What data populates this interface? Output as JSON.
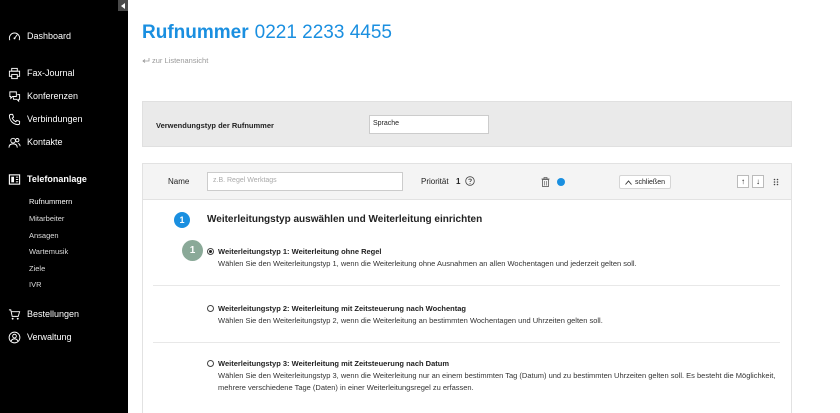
{
  "sidebar": {
    "items": [
      {
        "label": "Dashboard",
        "icon": "gauge-icon"
      },
      {
        "label": "Fax-Journal",
        "icon": "printer-icon"
      },
      {
        "label": "Konferenzen",
        "icon": "chat-icon"
      },
      {
        "label": "Verbindungen",
        "icon": "phone-icon"
      },
      {
        "label": "Kontakte",
        "icon": "contacts-icon"
      },
      {
        "label": "Telefonanlage",
        "icon": "pbx-icon"
      },
      {
        "label": "Bestellungen",
        "icon": "cart-icon"
      },
      {
        "label": "Verwaltung",
        "icon": "user-circle-icon"
      }
    ],
    "subitems": [
      {
        "label": "Rufnummern"
      },
      {
        "label": "Mitarbeiter"
      },
      {
        "label": "Ansagen"
      },
      {
        "label": "Wartemusik"
      },
      {
        "label": "Ziele"
      },
      {
        "label": "IVR"
      }
    ]
  },
  "header": {
    "title": "Rufnummer",
    "number": "0221 2233 4455",
    "back_link": "zur Listenansicht"
  },
  "usage": {
    "label": "Verwendungstyp der Rufnummer",
    "value": "Sprache"
  },
  "rule": {
    "name_label": "Name",
    "name_placeholder": "z.B. Regel Werktags",
    "priority_label": "Priorität",
    "priority_value": "1",
    "close_label": "schließen",
    "up_arrow": "↑",
    "down_arrow": "↓"
  },
  "section": {
    "step": "1",
    "title": "Weiterleitungstyp auswählen und Weiterleitung einrichten",
    "marker": "1",
    "options": [
      {
        "title": "Weiterleitungstyp 1: Weiterleitung ohne Regel",
        "desc": "Wählen Sie den Weiterleitungstyp 1, wenn die Weiterleitung ohne Ausnahmen an allen Wochentagen und jederzeit gelten soll.",
        "checked": true
      },
      {
        "title": "Weiterleitungstyp 2: Weiterleitung mit Zeitsteuerung nach Wochentag",
        "desc": "Wählen Sie den Weiterleitungstyp 2, wenn die Weiterleitung an bestimmten Wochentagen und Uhrzeiten gelten soll.",
        "checked": false
      },
      {
        "title": "Weiterleitungstyp 3: Weiterleitung mit Zeitsteuerung nach Datum",
        "desc": "Wählen Sie den Weiterleitungstyp 3, wenn die Weiterleitung nur an einem bestimmten Tag (Datum) und zu bestimmten Uhrzeiten gelten soll. Es besteht die Möglichkeit, mehrere verschiedene Tage (Daten) in einer Weiterleitungsregel zu erfassen.",
        "checked": false
      }
    ]
  },
  "colors": {
    "accent": "#1a8fe0",
    "sidebar_bg": "#000000",
    "marker": "#8aa998"
  }
}
